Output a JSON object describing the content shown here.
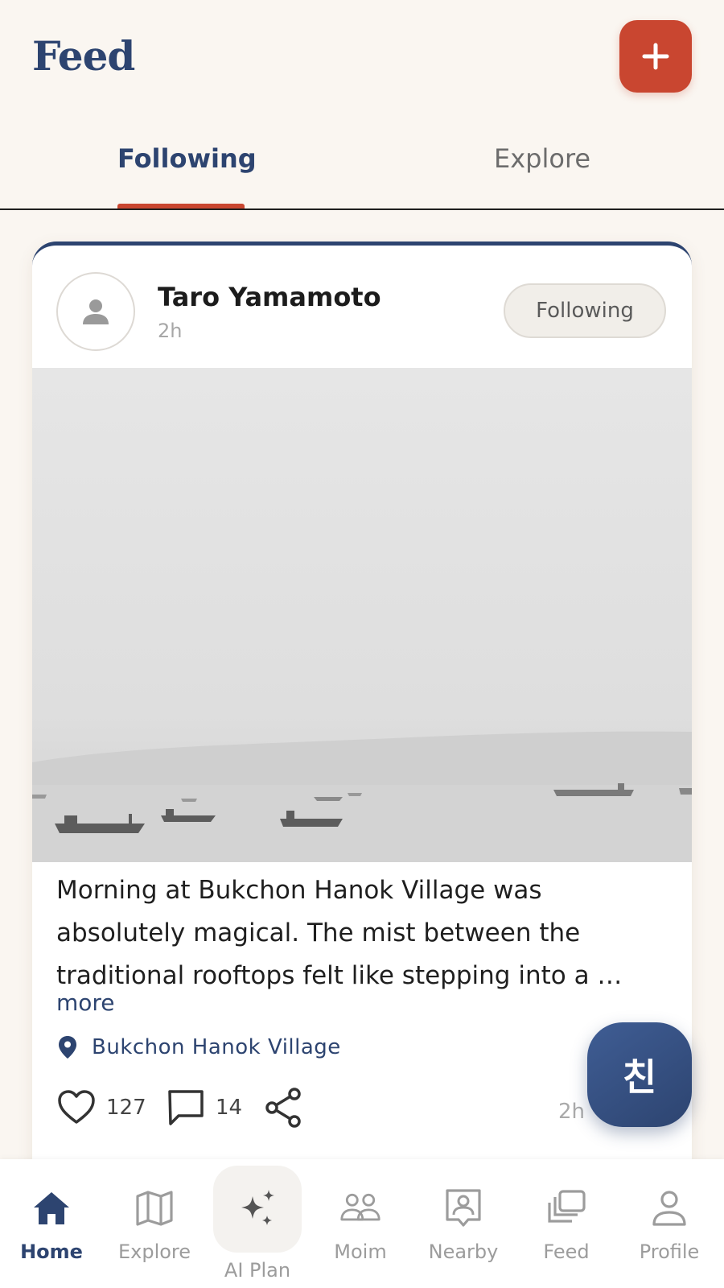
{
  "header": {
    "title": "Feed",
    "add_icon": "plus-icon"
  },
  "tabs": [
    {
      "label": "Following",
      "active": true
    },
    {
      "label": "Explore",
      "active": false
    }
  ],
  "post": {
    "author": "Taro Yamamoto",
    "time": "2h",
    "follow_label": "Following",
    "caption_lines": [
      "Morning at Bukchon Hanok Village was",
      "absolutely magical. The mist between the",
      "traditional rooftops felt like stepping into a …"
    ],
    "more_label": "more",
    "location": "Bukchon Hanok Village",
    "likes": "127",
    "comments": "14",
    "footer_time": "2h"
  },
  "fab": {
    "label": "친"
  },
  "nav": [
    {
      "label": "Home",
      "icon": "home-icon",
      "active": true
    },
    {
      "label": "Explore",
      "icon": "map-icon",
      "active": false
    },
    {
      "label": "AI Plan",
      "icon": "sparkles-icon",
      "active": false
    },
    {
      "label": "Moim",
      "icon": "group-icon",
      "active": false
    },
    {
      "label": "Nearby",
      "icon": "nearby-icon",
      "active": false
    },
    {
      "label": "Feed",
      "icon": "feed-icon",
      "active": false
    },
    {
      "label": "Profile",
      "icon": "profile-icon",
      "active": false
    }
  ],
  "colors": {
    "brand_navy": "#2d4470",
    "accent_red": "#c94630",
    "background": "#faf6f1"
  }
}
